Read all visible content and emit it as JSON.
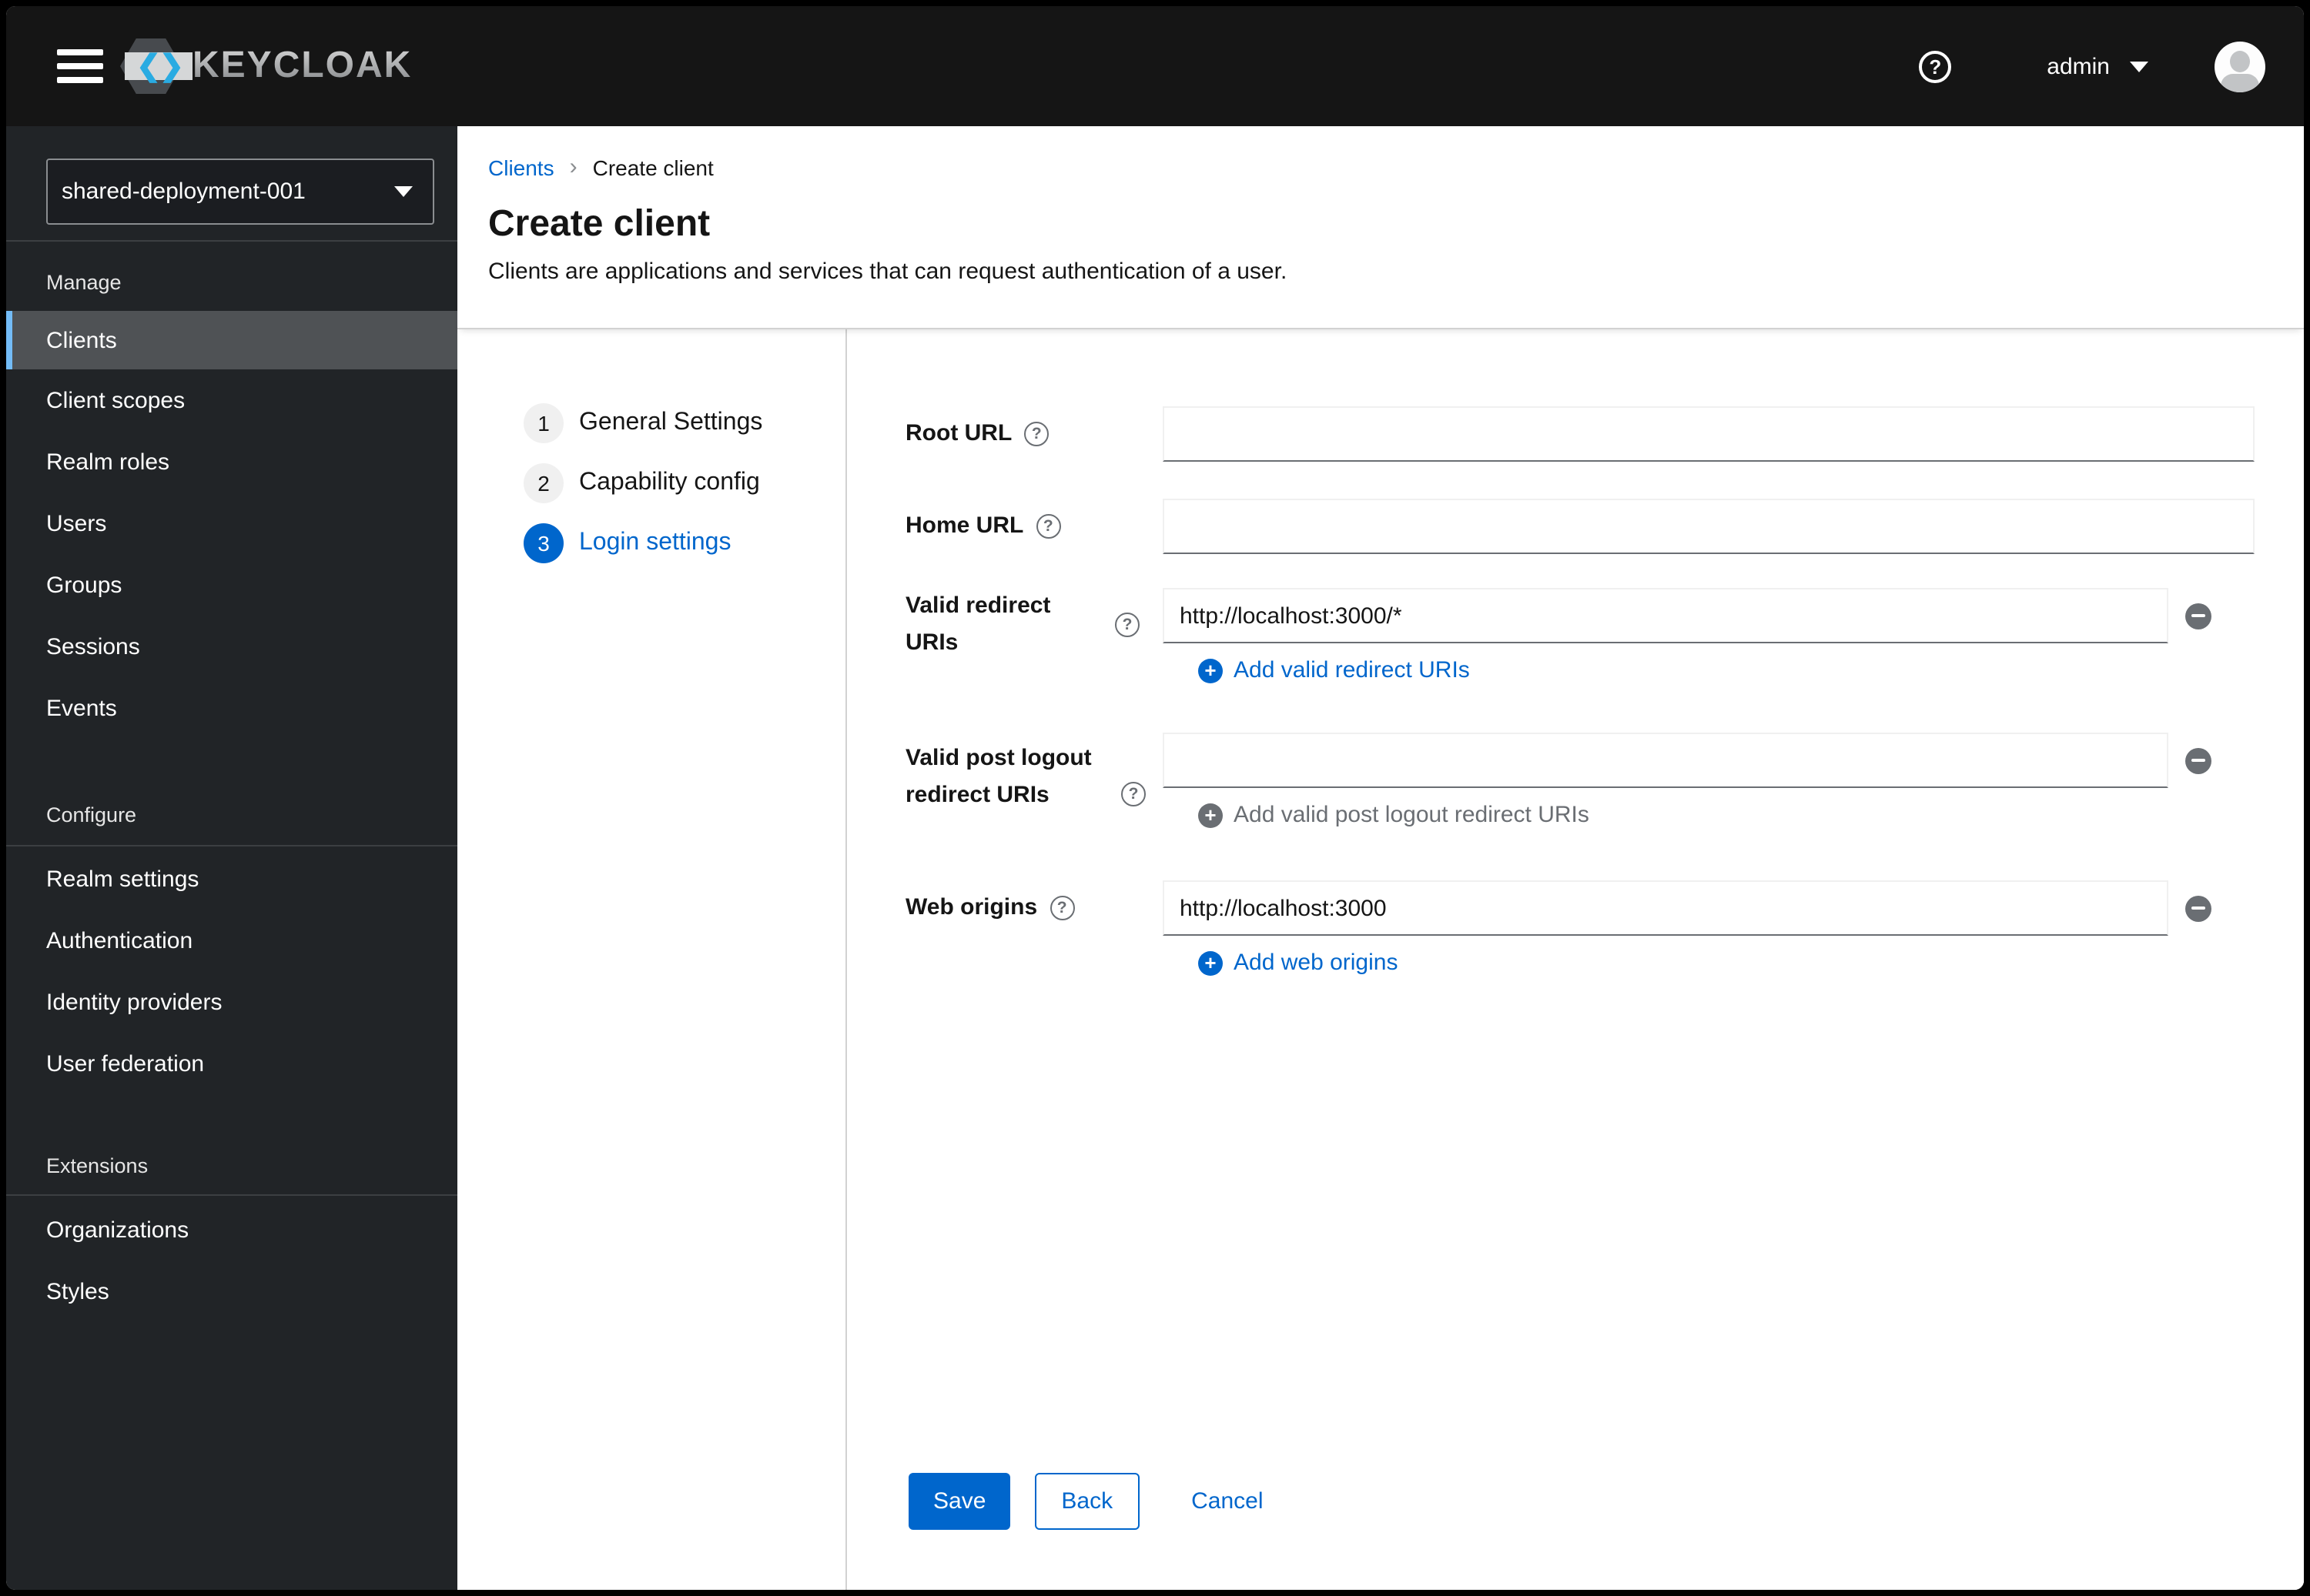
{
  "masthead": {
    "brand_text": "KEYCLOAK",
    "username": "admin"
  },
  "icons": {
    "help": "?",
    "plus": "+",
    "breadcrumb_chevron": "›",
    "logo_left_chevron": "❮",
    "logo_right_chevron": "❯"
  },
  "sidebar": {
    "realm_selector": {
      "value": "shared-deployment-001"
    },
    "sections": [
      {
        "label": "Manage",
        "items": [
          "Clients",
          "Client scopes",
          "Realm roles",
          "Users",
          "Groups",
          "Sessions",
          "Events"
        ],
        "selected_item": "Clients"
      },
      {
        "label": "Configure",
        "items": [
          "Realm settings",
          "Authentication",
          "Identity providers",
          "User federation"
        ]
      },
      {
        "label": "Extensions",
        "items": [
          "Organizations",
          "Styles"
        ]
      }
    ]
  },
  "breadcrumb": {
    "parent": "Clients",
    "current": "Create client"
  },
  "page_header": {
    "title": "Create client",
    "description": "Clients are applications and services that can request authentication of a user."
  },
  "wizard": {
    "steps": [
      {
        "number": "1",
        "label": "General Settings",
        "active": false
      },
      {
        "number": "2",
        "label": "Capability config",
        "active": false
      },
      {
        "number": "3",
        "label": "Login settings",
        "active": true
      }
    ]
  },
  "form": {
    "fields": [
      {
        "label": "Root URL",
        "value": ""
      },
      {
        "label": "Home URL",
        "value": ""
      },
      {
        "label": "Valid redirect URIs",
        "value": "http://localhost:3000/*",
        "add_label": "Add valid redirect URIs",
        "add_enabled": true
      },
      {
        "label": "Valid post logout redirect URIs",
        "value": "",
        "add_label": "Add valid post logout redirect URIs",
        "add_enabled": false
      },
      {
        "label": "Web origins",
        "value": "http://localhost:3000",
        "add_label": "Add web origins",
        "add_enabled": true
      }
    ],
    "actions": {
      "save": "Save",
      "back": "Back",
      "cancel": "Cancel"
    }
  },
  "colors": {
    "accent": "#0066cc",
    "masthead_bg": "#151515",
    "sidebar_bg": "#212427",
    "nav_selected_bg": "#4f5255",
    "nav_selected_accent": "#73bcf7",
    "muted": "#6a6e73",
    "divider": "#d2d2d2"
  }
}
